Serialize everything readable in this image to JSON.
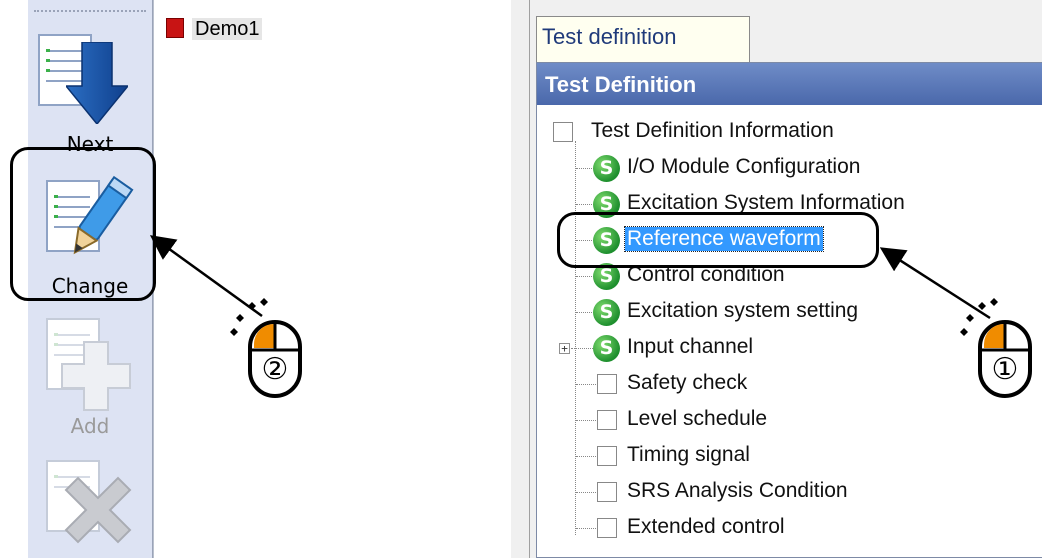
{
  "toolbar": {
    "next_label": "Next",
    "change_label": "Change",
    "add_label": "Add"
  },
  "left_pane": {
    "items": [
      {
        "label": "Demo1"
      }
    ]
  },
  "right_pane": {
    "tab_label": "Test definition",
    "panel_title": "Test Definition",
    "tree": [
      {
        "label": "Test Definition Information",
        "icon": "checkbox"
      },
      {
        "label": "I/O Module Configuration",
        "icon": "s-icon"
      },
      {
        "label": "Excitation System Information",
        "icon": "s-icon"
      },
      {
        "label": "Reference waveform",
        "icon": "s-icon",
        "selected": true
      },
      {
        "label": "Control condition",
        "icon": "s-icon"
      },
      {
        "label": "Excitation system setting",
        "icon": "s-icon"
      },
      {
        "label": "Input channel",
        "icon": "s-icon",
        "expandable": true
      },
      {
        "label": "Safety check",
        "icon": "checkbox"
      },
      {
        "label": "Level schedule",
        "icon": "checkbox"
      },
      {
        "label": "Timing signal",
        "icon": "checkbox"
      },
      {
        "label": "SRS Analysis Condition",
        "icon": "checkbox"
      },
      {
        "label": "Extended control",
        "icon": "checkbox"
      }
    ]
  },
  "annotations": {
    "step1": "①",
    "step2": "②"
  },
  "colors": {
    "toolbar_bg": "#dde3f3",
    "selection": "#3399ff",
    "panel_header": "#4a68ab",
    "mouse_button": "#f08c00"
  }
}
